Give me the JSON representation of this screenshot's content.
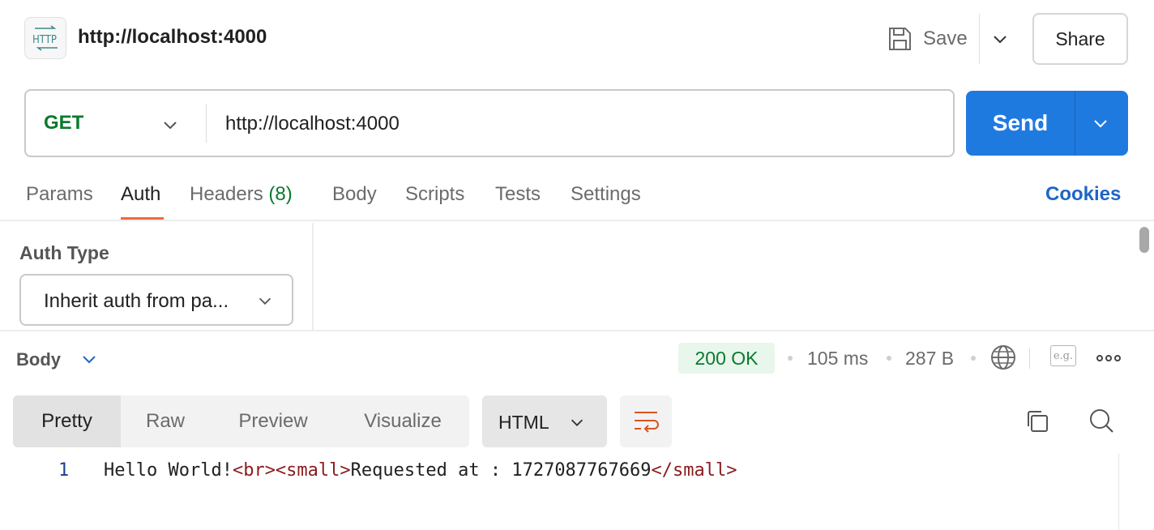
{
  "header": {
    "icon": "http-icon",
    "icon_text": "HTTP",
    "title": "http://localhost:4000",
    "save_label": "Save",
    "share_label": "Share"
  },
  "request": {
    "method": "GET",
    "url": "http://localhost:4000",
    "send_label": "Send"
  },
  "tabs": {
    "params": "Params",
    "auth": "Auth",
    "headers": "Headers",
    "headers_count": "(8)",
    "body": "Body",
    "scripts": "Scripts",
    "tests": "Tests",
    "settings": "Settings",
    "active": "Auth",
    "cookies": "Cookies"
  },
  "auth": {
    "label": "Auth Type",
    "selected": "Inherit auth from pa..."
  },
  "response": {
    "body_label": "Body",
    "status": "200 OK",
    "time": "105 ms",
    "size": "287 B",
    "example_label": "e.g.",
    "views": [
      "Pretty",
      "Raw",
      "Preview",
      "Visualize"
    ],
    "active_view": "Pretty",
    "format": "HTML",
    "code": {
      "line_number": "1",
      "text_1": "Hello World!",
      "tag_1": "<br><small>",
      "text_2": "Requested at : 1727087767669",
      "tag_2": "</small>"
    }
  },
  "colors": {
    "accent": "#1f7ae0",
    "method_get": "#0b7a2e",
    "active_tab_underline": "#f26b3a",
    "status_ok_bg": "#e8f6ec",
    "link": "#1f66c4"
  }
}
